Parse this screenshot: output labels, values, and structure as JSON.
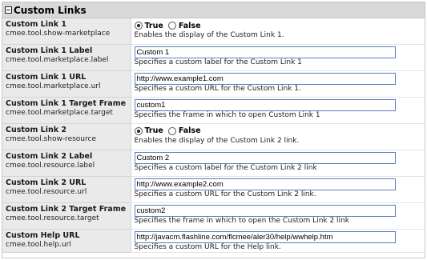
{
  "section": {
    "title": "Custom Links"
  },
  "rows": [
    {
      "title": "Custom Link 1",
      "key": "cmee.tool.show-marketplace",
      "type": "radio",
      "options": [
        "True",
        "False"
      ],
      "selected": "True",
      "desc": "Enables the display of the Custom Link 1."
    },
    {
      "title": "Custom Link 1 Label",
      "key": "cmee.tool.marketplace.label",
      "type": "text",
      "value": "Custom 1",
      "desc": "Specifies a custom label for the Custom Link 1"
    },
    {
      "title": "Custom Link 1 URL",
      "key": "cmee.tool.marketplace.url",
      "type": "text",
      "value": "http://www.example1.com",
      "desc": "Specifies a custom URL for the Custom Link 1."
    },
    {
      "title": "Custom Link 1 Target Frame",
      "key": "cmee.tool.marketplace.target",
      "type": "text",
      "value": "custom1",
      "desc": "Specifies the frame in which to open Custom Link 1"
    },
    {
      "title": "Custom Link 2",
      "key": "cmee.tool.show-resource",
      "type": "radio",
      "options": [
        "True",
        "False"
      ],
      "selected": "True",
      "desc": "Enables the display of the Custom Link 2 link."
    },
    {
      "title": "Custom Link 2 Label",
      "key": "cmee.tool.resource.label",
      "type": "text",
      "value": "Custom 2",
      "desc": "Specifies a custom label for the Custom Link 2 link"
    },
    {
      "title": "Custom Link 2 URL",
      "key": "cmee.tool.resource.url",
      "type": "text",
      "value": "http://www.example2.com",
      "desc": "Specifies a custom URL for the Custom Link 2 link."
    },
    {
      "title": "Custom Link 2 Target Frame",
      "key": "cmee.tool.resource.target",
      "type": "text",
      "value": "custom2",
      "desc": "Specifies the frame in which to open the Custom Link 2 link"
    },
    {
      "title": "Custom Help URL",
      "key": "cmee.tool.help.url",
      "type": "text",
      "value": "http://javacm.flashline.com/flcmee/aler30/help/wwhelp.htm",
      "desc": "Specifies a custom URL for the Help link."
    }
  ]
}
